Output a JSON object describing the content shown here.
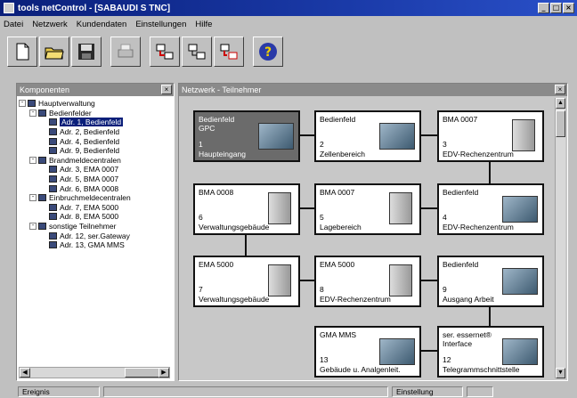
{
  "window": {
    "title": "tools netControl  -  [SABAUDI S TNC]"
  },
  "menu": [
    "Datei",
    "Netzwerk",
    "Kundendaten",
    "Einstellungen",
    "Hilfe"
  ],
  "toolbar": {
    "icons": [
      "new-document-icon",
      "open-folder-icon",
      "save-disk-icon",
      "print-icon",
      "network-connect-icon",
      "network-view-icon",
      "network-disconnect-icon",
      "help-icon"
    ]
  },
  "left_pane": {
    "title": "Komponenten",
    "tree": [
      {
        "label": "Hauptverwaltung",
        "indent": 0,
        "toggle": "-"
      },
      {
        "label": "Bedienfelder",
        "indent": 1,
        "toggle": "-"
      },
      {
        "label": "Adr. 1, Bedienfeld",
        "indent": 2,
        "selected": true
      },
      {
        "label": "Adr. 2, Bedienfeld",
        "indent": 2
      },
      {
        "label": "Adr. 4, Bedienfeld",
        "indent": 2
      },
      {
        "label": "Adr. 9, Bedienfeld",
        "indent": 2
      },
      {
        "label": "Brandmeldecentralen",
        "indent": 1,
        "toggle": "-"
      },
      {
        "label": "Adr. 3, EMA 0007",
        "indent": 2
      },
      {
        "label": "Adr. 5, BMA 0007",
        "indent": 2
      },
      {
        "label": "Adr. 6, BMA 0008",
        "indent": 2
      },
      {
        "label": "Einbruchmeldecentralen",
        "indent": 1,
        "toggle": "-"
      },
      {
        "label": "Adr. 7, EMA 5000",
        "indent": 2
      },
      {
        "label": "Adr. 8, EMA 5000",
        "indent": 2
      },
      {
        "label": "sonstige Teilnehmer",
        "indent": 1,
        "toggle": "-"
      },
      {
        "label": "Adr. 12, ser.Gateway",
        "indent": 2
      },
      {
        "label": "Adr. 13, GMA MMS",
        "indent": 2
      }
    ]
  },
  "right_pane": {
    "title": "Netzwerk - Teilnehmer",
    "nodes": [
      {
        "line1": "Bedienfeld",
        "line2": "GPC",
        "num": "1",
        "loc": "Haupteingang",
        "dark": true
      },
      {
        "line1": "Bedienfeld",
        "line2": "",
        "num": "2",
        "loc": "Zellenbereich"
      },
      {
        "line1": "BMA 0007",
        "line2": "",
        "num": "3",
        "loc": "EDV-Rechenzentrum"
      },
      {
        "line1": "BMA 0008",
        "line2": "",
        "num": "6",
        "loc": "Verwaltungsgebäude"
      },
      {
        "line1": "BMA 0007",
        "line2": "",
        "num": "5",
        "loc": "Lagebereich"
      },
      {
        "line1": "Bedienfeld",
        "line2": "",
        "num": "4",
        "loc": "EDV-Rechenzentrum"
      },
      {
        "line1": "EMA 5000",
        "line2": "",
        "num": "7",
        "loc": "Verwaltungsgebäude"
      },
      {
        "line1": "EMA 5000",
        "line2": "",
        "num": "8",
        "loc": "EDV-Rechenzentrum"
      },
      {
        "line1": "Bedienfeld",
        "line2": "",
        "num": "9",
        "loc": "Ausgang Arbeit"
      },
      {
        "line1": "GMA MMS",
        "line2": "",
        "num": "13",
        "loc": "Gebäude u. Analgenleit."
      },
      {
        "line1": "ser. essernet®",
        "line2": "Interface",
        "num": "12",
        "loc": "Telegrammschnittstelle"
      }
    ]
  },
  "status": {
    "left": "Ereignis",
    "right": "Einstellung"
  }
}
